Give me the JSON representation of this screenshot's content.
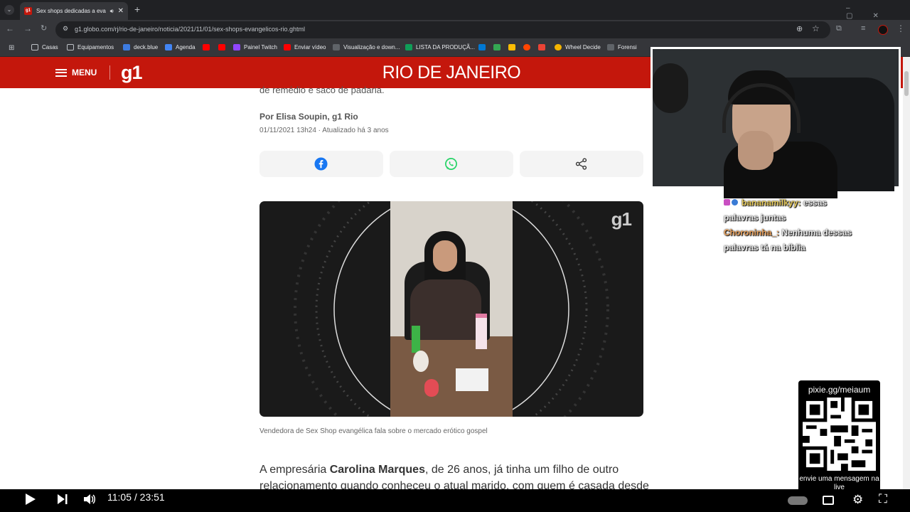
{
  "browser": {
    "tab_title": "Sex shops dedicadas a evan",
    "url": "g1.globo.com/rj/rio-de-janeiro/noticia/2021/11/01/sex-shops-evangelicos-rio.ghtml",
    "bookmarks": [
      "Casas",
      "Equipamentos",
      "deck.blue",
      "Agenda",
      "Painel Twitch",
      "Enviar vídeo",
      "Visualização e down...",
      "LISTA DA PRODUÇÃ...",
      "Wheel Decide",
      "Forensi"
    ]
  },
  "site": {
    "menu_label": "MENU",
    "logo": "g1",
    "section_title": "RIO DE JANEIRO"
  },
  "article": {
    "lead_fragment": "de remédio e saco de padaria.",
    "byline": "Por Elisa Soupin, g1 Rio",
    "date": "01/11/2021 13h24 · Atualizado há 3 anos",
    "video_watermark": "g1",
    "video_caption": "Vendedora de Sex Shop evangélica fala sobre o mercado erótico gospel",
    "para_intro": "A empresária ",
    "para_name": "Carolina Marques",
    "para_rest": ", de 26 anos, já tinha um filho de outro",
    "para_line2": "relacionamento quando conheceu o atual marido, com quem é casada desde"
  },
  "chat": [
    {
      "user": "bananamilkyy:",
      "message": " essas",
      "color": "#e5c85a"
    },
    {
      "user": "",
      "message": "palavras juntas",
      "color": "#e9e9e9"
    },
    {
      "user": "Choroninha_:",
      "message": " Nenhuma dessas",
      "color": "#e8a05a"
    },
    {
      "user": "",
      "message": "palavras tá na bíblia",
      "color": "#e9e9e9"
    }
  ],
  "qr": {
    "url": "pixie.gg/meiaum",
    "cta": "envie uma mensagem na live"
  },
  "player": {
    "time": "11:05 / 23:51"
  }
}
